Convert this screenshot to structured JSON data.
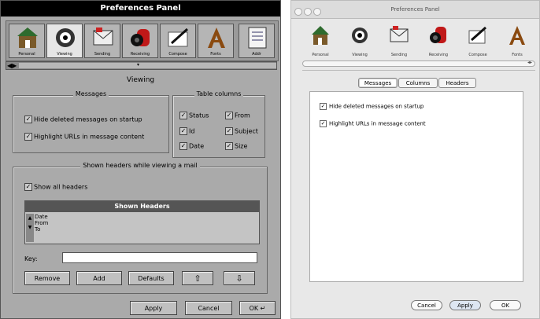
{
  "left": {
    "title": "Preferences Panel",
    "icons": [
      {
        "label": "Personal",
        "name": "house-icon"
      },
      {
        "label": "Viewing",
        "name": "eye-icon",
        "selected": true
      },
      {
        "label": "Sending",
        "name": "envelope-icon"
      },
      {
        "label": "Receiving",
        "name": "mailbox-icon"
      },
      {
        "label": "Compose",
        "name": "pen-icon"
      },
      {
        "label": "Fonts",
        "name": "font-icon"
      },
      {
        "label": "Addr",
        "name": "address-book-icon"
      }
    ],
    "section_title": "Viewing",
    "messages_group": {
      "title": "Messages",
      "options": [
        "Hide deleted messages on startup",
        "Highlight URLs in message content"
      ]
    },
    "columns_group": {
      "title": "Table columns",
      "options": [
        "Status",
        "From",
        "Id",
        "Subject",
        "Date",
        "Size"
      ]
    },
    "headers_group": {
      "title": "Shown headers while viewing a mail",
      "show_all": "Show all headers",
      "list_header": "Shown Headers",
      "rows": [
        "Date",
        "From",
        "To"
      ]
    },
    "key_label": "Key:",
    "buttons": {
      "remove": "Remove",
      "add": "Add",
      "defaults": "Defaults",
      "up": "⇧",
      "down": "⇩"
    },
    "bottom": {
      "apply": "Apply",
      "cancel": "Cancel",
      "ok": "OK ↵"
    }
  },
  "right": {
    "title": "Preferences Panel",
    "icons": [
      {
        "label": "Personal",
        "name": "house-icon"
      },
      {
        "label": "Viewing",
        "name": "eye-icon"
      },
      {
        "label": "Sending",
        "name": "envelope-icon"
      },
      {
        "label": "Receiving",
        "name": "mailbox-icon"
      },
      {
        "label": "Compose",
        "name": "pen-icon"
      },
      {
        "label": "Fonts",
        "name": "font-icon"
      }
    ],
    "tabs": [
      "Messages",
      "Columns",
      "Headers"
    ],
    "options": [
      "Hide deleted messages on startup",
      "Highlight URLs in message content"
    ],
    "bottom": {
      "cancel": "Cancel",
      "apply": "Apply",
      "ok": "OK"
    }
  },
  "colors": {
    "next_gray": "#aaaaaa",
    "next_black": "#000000",
    "mac_bg": "#e8e8e8"
  }
}
